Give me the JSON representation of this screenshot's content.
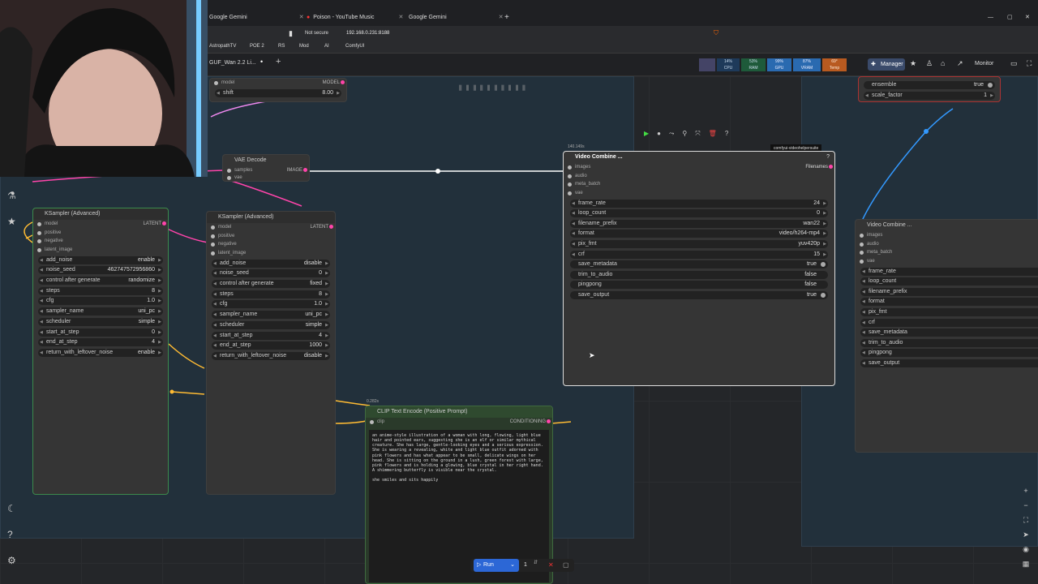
{
  "browser": {
    "tabs": [
      "Google Gemini",
      "Poison - YouTube Music",
      "Google Gemini"
    ],
    "not_secure": "Not secure",
    "url": "192.168.0.231:8188",
    "bookmarks": [
      "AstropathTV",
      "POE 2",
      "RS",
      "Mod",
      "AI",
      "ComfyUI"
    ]
  },
  "comfy": {
    "workflow_tab": "GUF_Wan 2.2 Li...",
    "manager_label": "Manager",
    "monitor_label": "Monitor",
    "stats": {
      "cpu": "14%",
      "ram": "53%",
      "gpu": "99%",
      "vram": "87%",
      "temp": "69°"
    },
    "stat_labels": {
      "cpu": "CPU",
      "ram": "RAM",
      "gpu": "GPU",
      "vram": "VRAM",
      "temp": "Temp"
    }
  },
  "nodes": {
    "model_shift": {
      "model_label": "model",
      "model_out": "MODEL",
      "shift_label": "shift",
      "shift_value": "8.00"
    },
    "vae_decode": {
      "title": "VAE Decode",
      "samples": "samples",
      "vae": "vae",
      "out": "IMAGE"
    },
    "ksampler1": {
      "title": "KSampler (Advanced)",
      "out": "LATENT",
      "inputs": [
        "model",
        "positive",
        "negative",
        "latent_image"
      ],
      "widgets": [
        {
          "label": "add_noise",
          "value": "enable"
        },
        {
          "label": "noise_seed",
          "value": "462747572956860"
        },
        {
          "label": "control after generate",
          "value": "randomize"
        },
        {
          "label": "steps",
          "value": "8"
        },
        {
          "label": "cfg",
          "value": "1.0"
        },
        {
          "label": "sampler_name",
          "value": "uni_pc"
        },
        {
          "label": "scheduler",
          "value": "simple"
        },
        {
          "label": "start_at_step",
          "value": "0"
        },
        {
          "label": "end_at_step",
          "value": "4"
        },
        {
          "label": "return_with_leftover_noise",
          "value": "enable"
        }
      ]
    },
    "ksampler2": {
      "title": "KSampler (Advanced)",
      "out": "LATENT",
      "inputs": [
        "model",
        "positive",
        "negative",
        "latent_image"
      ],
      "widgets": [
        {
          "label": "add_noise",
          "value": "disable"
        },
        {
          "label": "noise_seed",
          "value": "0"
        },
        {
          "label": "control after generate",
          "value": "fixed"
        },
        {
          "label": "steps",
          "value": "8"
        },
        {
          "label": "cfg",
          "value": "1.0"
        },
        {
          "label": "sampler_name",
          "value": "uni_pc"
        },
        {
          "label": "scheduler",
          "value": "simple"
        },
        {
          "label": "start_at_step",
          "value": "4"
        },
        {
          "label": "end_at_step",
          "value": "1000"
        },
        {
          "label": "return_with_leftover_noise",
          "value": "disable"
        }
      ]
    },
    "video_combine1": {
      "title": "Video Combine",
      "time": "140.149s",
      "badge": "comfyui-videohelpersuite",
      "inputs": [
        "images",
        "audio",
        "meta_batch",
        "vae"
      ],
      "out": "Filenames",
      "widgets": [
        {
          "label": "frame_rate",
          "value": "24"
        },
        {
          "label": "loop_count",
          "value": "0"
        },
        {
          "label": "filename_prefix",
          "value": "wan22"
        },
        {
          "label": "format",
          "value": "video/h264-mp4"
        },
        {
          "label": "pix_fmt",
          "value": "yuv420p"
        },
        {
          "label": "crf",
          "value": "15"
        },
        {
          "label": "save_metadata",
          "value": "true"
        },
        {
          "label": "trim_to_audio",
          "value": "false"
        },
        {
          "label": "pingpong",
          "value": "false"
        },
        {
          "label": "save_output",
          "value": "true"
        }
      ]
    },
    "video_combine2": {
      "title": "Video Combine",
      "inputs": [
        "images",
        "audio",
        "meta_batch",
        "vae"
      ],
      "widgets": [
        "frame_rate",
        "loop_count",
        "filename_prefix",
        "format",
        "pix_fmt",
        "crf",
        "save_metadata",
        "trim_to_audio",
        "pingpong",
        "save_output"
      ]
    },
    "ensemble": {
      "ensemble_label": "ensemble",
      "ensemble_value": "true",
      "scale_label": "scale_factor",
      "scale_value": "1"
    },
    "clip_text": {
      "title": "CLIP Text Encode (Positive Prompt)",
      "time": "0.282s",
      "clip": "clip",
      "out": "CONDITIONING",
      "prompt": "an anime-style illustration of a woman with long, flowing, light blue hair and pointed ears, suggesting she is an elf or similar mythical creature. She has large, gentle-looking eyes and a serious expression. She is wearing a revealing, white and light blue outfit adorned with pink flowers and has what appear to be small, delicate wings on her head. She is sitting on the ground in a lush, green forest with large, pink flowers and is holding a glowing, blue crystal in her right hand. A shimmering butterfly is visible near the crystal.",
      "prompt2": "she smiles and sits happily"
    }
  },
  "runbar": {
    "run_label": "Run",
    "count": "1"
  }
}
